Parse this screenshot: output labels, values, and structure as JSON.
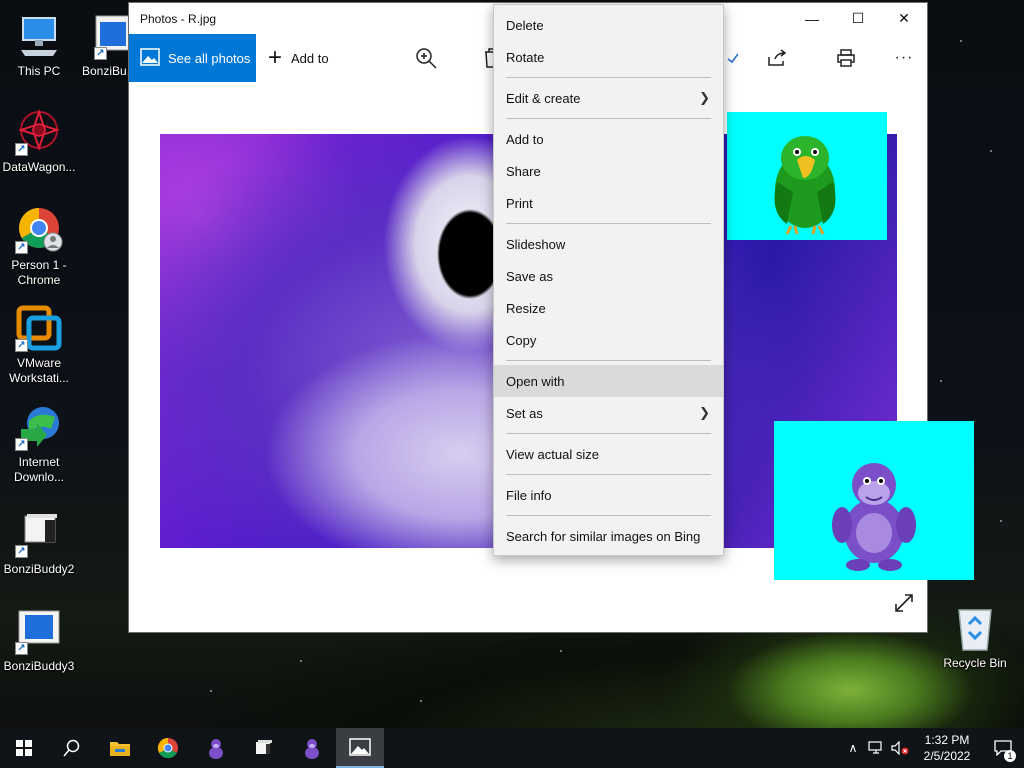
{
  "window": {
    "title": "Photos - R.jpg",
    "minimize": "—",
    "maximize": "☐",
    "close": "✕"
  },
  "toolbar": {
    "see_all_photos": "See all photos",
    "add_to": "Add to",
    "more": "···"
  },
  "context_menu": {
    "items": [
      {
        "label": "Delete"
      },
      {
        "label": "Rotate"
      },
      {
        "label": "Edit & create",
        "submenu": true
      },
      {
        "label": "Add to"
      },
      {
        "label": "Share"
      },
      {
        "label": "Print"
      },
      {
        "label": "Slideshow"
      },
      {
        "label": "Save as"
      },
      {
        "label": "Resize"
      },
      {
        "label": "Copy"
      },
      {
        "label": "Open with",
        "highlighted": true
      },
      {
        "label": "Set as",
        "submenu": true
      },
      {
        "label": "View actual size"
      },
      {
        "label": "File info"
      },
      {
        "label": "Search for similar images on Bing"
      }
    ]
  },
  "desktop_icons": [
    {
      "label": "This PC",
      "icon": "computer-icon"
    },
    {
      "label": "BonziBu...",
      "icon": "bonzibuddy-icon"
    },
    {
      "label": "DataWagon...",
      "icon": "datawagon-icon"
    },
    {
      "label": "Person 1 - Chrome",
      "icon": "chrome-icon"
    },
    {
      "label": "VMware Workstati...",
      "icon": "vmware-icon"
    },
    {
      "label": "Internet Downlo...",
      "icon": "idm-icon"
    },
    {
      "label": "BonziBuddy2",
      "icon": "bonzibuddy-icon"
    },
    {
      "label": "BonziBuddy3",
      "icon": "bonzibuddy-icon"
    },
    {
      "label": "Recycle Bin",
      "icon": "recycle-bin-icon"
    }
  ],
  "taskbar": {
    "time": "1:32 PM",
    "date": "2/5/2022",
    "notification_count": "1"
  },
  "colors": {
    "accent": "#0078d7",
    "agent_bg": "#00ffff"
  }
}
